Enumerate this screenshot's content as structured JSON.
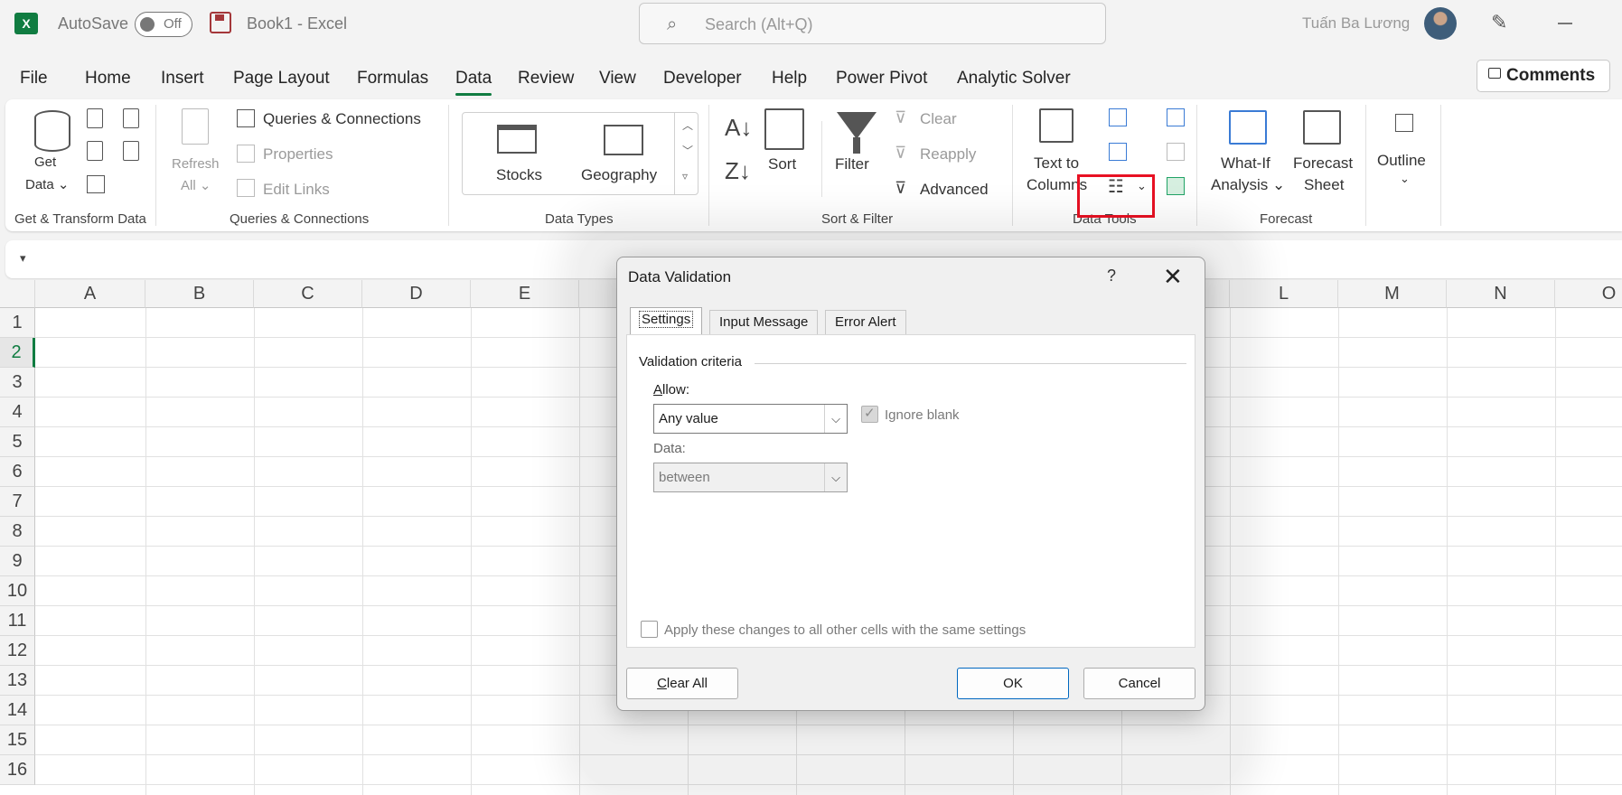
{
  "titlebar": {
    "autosave_label": "AutoSave",
    "autosave_state": "Off",
    "doc_title": "Book1  -  Excel",
    "search_placeholder": "Search (Alt+Q)",
    "user_name": "Tuấn Ba Lương",
    "app_icon_letter": "X"
  },
  "menu": {
    "tabs": [
      "File",
      "Home",
      "Insert",
      "Page Layout",
      "Formulas",
      "Data",
      "Review",
      "View",
      "Developer",
      "Help",
      "Power Pivot",
      "Analytic Solver"
    ],
    "active_tab": "Data",
    "comments_label": "Comments"
  },
  "ribbon": {
    "get_data": "Get",
    "get_data2": "Data",
    "refresh_all": "Refresh",
    "refresh_all2": "All",
    "queries_connections": "Queries & Connections",
    "properties": "Properties",
    "edit_links": "Edit Links",
    "stocks": "Stocks",
    "geography": "Geography",
    "sort": "Sort",
    "filter": "Filter",
    "clear": "Clear",
    "reapply": "Reapply",
    "advanced": "Advanced",
    "text_to_columns": "Text to",
    "text_to_columns2": "Columns",
    "what_if": "What-If",
    "what_if2": "Analysis",
    "forecast_sheet": "Forecast",
    "forecast_sheet2": "Sheet",
    "outline": "Outline",
    "groups": {
      "get_transform": "Get & Transform Data",
      "queries_connections": "Queries & Connections",
      "data_types": "Data Types",
      "sort_filter": "Sort & Filter",
      "data_tools": "Data Tools",
      "forecast": "Forecast"
    }
  },
  "sheet": {
    "columns": [
      "A",
      "B",
      "C",
      "D",
      "E",
      "L",
      "M",
      "N",
      "O"
    ],
    "rows": [
      "1",
      "2",
      "3",
      "4",
      "5",
      "6",
      "7",
      "8",
      "9",
      "10",
      "11",
      "12",
      "13",
      "14",
      "15",
      "16"
    ],
    "selected_row": "2"
  },
  "dialog": {
    "title": "Data Validation",
    "help": "?",
    "tabs": [
      "Settings",
      "Input Message",
      "Error Alert"
    ],
    "active_tab": "Settings",
    "section": "Validation criteria",
    "allow_label_u": "A",
    "allow_label_rest": "llow:",
    "allow_value": "Any value",
    "ignore_blank": "Ignore blank",
    "data_label": "Data:",
    "data_value": "between",
    "apply_all": "Apply these changes to all other cells with the same settings",
    "clear_all_u": "C",
    "clear_all_rest": "lear All",
    "ok": "OK",
    "cancel": "Cancel"
  },
  "colors": {
    "excel_green": "#107c41",
    "highlight_red": "#e81123",
    "ok_border": "#0067c0"
  }
}
